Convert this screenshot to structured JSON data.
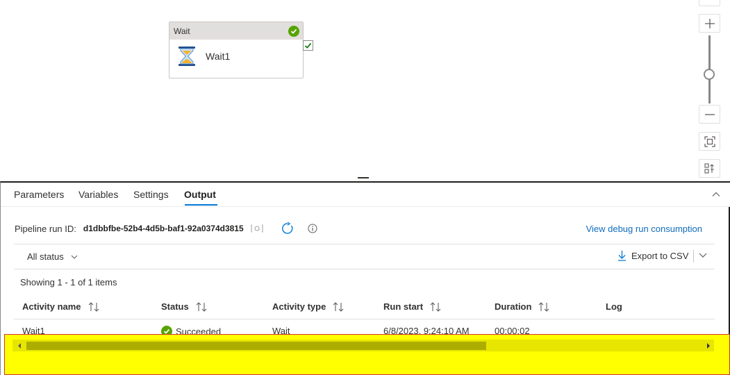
{
  "canvas": {
    "activity": {
      "type_label": "Wait",
      "name": "Wait1"
    }
  },
  "zoom": {
    "level_fraction": 0.5
  },
  "tabs": [
    {
      "label": "Parameters"
    },
    {
      "label": "Variables"
    },
    {
      "label": "Settings"
    },
    {
      "label": "Output",
      "active": true
    }
  ],
  "output": {
    "run_id_label": "Pipeline run ID:",
    "run_id": "d1dbbfbe-52b4-4d5b-baf1-92a0374d3815",
    "debug_link": "View debug run consumption",
    "status_filter": "All status",
    "export_label": "Export to CSV",
    "showing": "Showing 1 - 1 of 1 items",
    "columns": [
      "Activity name",
      "Status",
      "Activity type",
      "Run start",
      "Duration",
      "Log"
    ],
    "rows": [
      {
        "activity_name": "Wait1",
        "status": "Succeeded",
        "activity_type": "Wait",
        "run_start": "6/8/2023, 9:24:10 AM",
        "duration": "00:00:02"
      }
    ]
  },
  "scrollbar": {
    "thumb_fraction": 0.66
  },
  "colors": {
    "accent": "#0078d4",
    "success": "#57a300",
    "link": "#0f6cbd",
    "highlight": "#ffff00"
  },
  "icons": [
    "checkmark-icon",
    "hourglass-icon",
    "zoom-in-icon",
    "zoom-out-icon",
    "fit-to-screen-icon",
    "auto-align-icon",
    "chevron-up-icon",
    "copy-icon",
    "refresh-icon",
    "info-icon",
    "chevron-down-icon",
    "download-icon",
    "sort-icon"
  ]
}
